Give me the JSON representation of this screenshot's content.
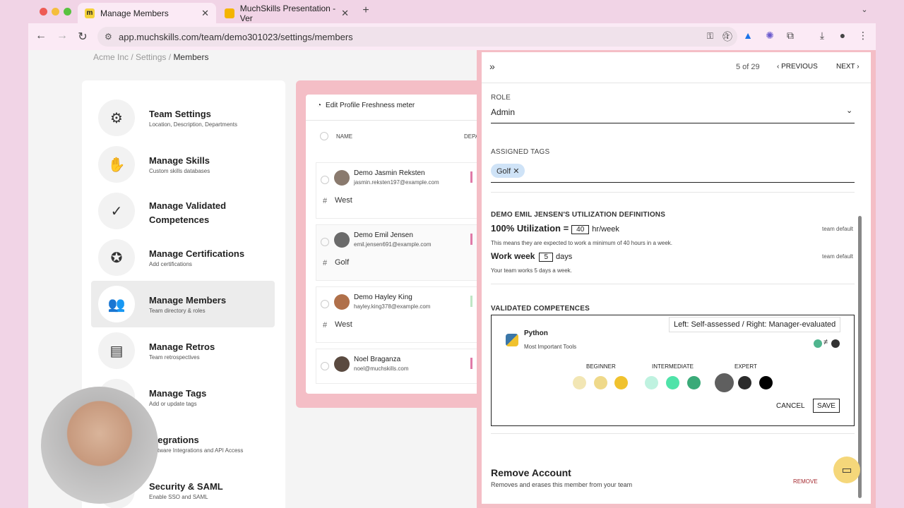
{
  "browser": {
    "tabs": [
      {
        "title": "Manage Members",
        "favicon": "m",
        "active": true
      },
      {
        "title": "MuchSkills Presentation - Ver",
        "favicon": "slides",
        "active": false
      }
    ],
    "url": "app.muchskills.com/team/demo301023/settings/members"
  },
  "breadcrumb": {
    "root": "Acme Inc",
    "sep": "/",
    "mid": "Settings",
    "current": "Members"
  },
  "settings_nav": [
    {
      "title": "Team Settings",
      "sub": "Location, Description, Departments",
      "icon": "gear-icon"
    },
    {
      "title": "Manage Skills",
      "sub": "Custom skills databases",
      "icon": "puzzle-icon"
    },
    {
      "title": "Manage Validated Competences",
      "sub": "",
      "icon": "badge-check-icon"
    },
    {
      "title": "Manage Certifications",
      "sub": "Add certifications",
      "icon": "award-icon"
    },
    {
      "title": "Manage Members",
      "sub": "Team directory & roles",
      "icon": "people-icon"
    },
    {
      "title": "Manage Retros",
      "sub": "Team retrospectives",
      "icon": "document-icon"
    },
    {
      "title": "Manage Tags",
      "sub": "Add or update tags",
      "icon": "tag-icon"
    },
    {
      "title": "ntegrations",
      "sub": "Software Integrations and API Access",
      "icon": "plug-icon"
    },
    {
      "title": "Security & SAML",
      "sub": "Enable SSO and SAML",
      "icon": "lock-icon"
    }
  ],
  "members": {
    "freshness_label": "Edit Profile Freshness meter",
    "col_name": "NAME",
    "col_dept": "DEPA",
    "rows": [
      {
        "name": "Demo Jasmin Reksten",
        "email": "jasmin.reksten197@example.com",
        "tag": "West"
      },
      {
        "name": "Demo Emil Jensen",
        "email": "emil.jensen691@example.com",
        "tag": "Golf"
      },
      {
        "name": "Demo Hayley King",
        "email": "hayley.king378@example.com",
        "tag": "West"
      },
      {
        "name": "Noel Braganza",
        "email": "noel@muchskills.com",
        "tag": ""
      }
    ]
  },
  "side_panel": {
    "pager": "5 of 29",
    "prev": "PREVIOUS",
    "next": "NEXT",
    "role_label": "ROLE",
    "role_value": "Admin",
    "tags_label": "ASSIGNED TAGS",
    "tag": "Golf ✕",
    "util_label": "DEMO EMIL JENSEN'S UTILIZATION DEFINITIONS",
    "util_title": "100% Utilization =",
    "util_hours": "40",
    "util_unit": "hr/week",
    "util_default": "team default",
    "util_note": "This means they are expected to work a minimum of 40 hours in a week.",
    "week_title": "Work week",
    "week_days": "5",
    "week_unit": "days",
    "week_default": "team default",
    "week_note": "Your team works 5 days a week.",
    "vc_label": "VALIDATED COMPETENCES",
    "skill_name": "Python",
    "skill_cat": "Most Important Tools",
    "levels": [
      "BEGINNER",
      "INTERMEDIATE",
      "EXPERT"
    ],
    "tooltip": "Left: Self-assessed / Right: Manager-evaluated",
    "cancel": "CANCEL",
    "save": "SAVE",
    "remove_title": "Remove Account",
    "remove_note": "Removes and erases this member from your team",
    "remove_btn": "REMOVE",
    "dot_colors": [
      "#f2e6b4",
      "#efd98a",
      "#f0c22e",
      "#bff2e0",
      "#4fe3a9",
      "#3aaa78",
      "#5f5f5f",
      "#2b2b2b",
      "#000000"
    ]
  }
}
